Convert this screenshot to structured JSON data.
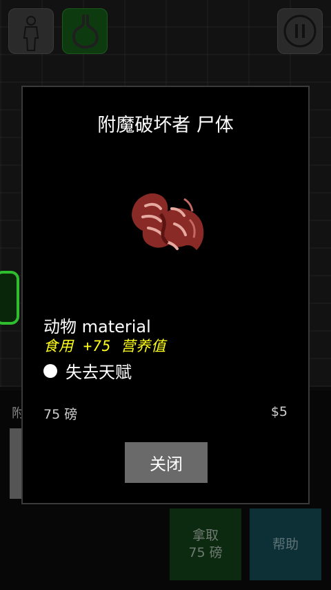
{
  "background": {
    "partial_label": "附",
    "take_button_label_line1": "拿取",
    "take_button_label_line2": "75 磅",
    "help_button_label": "帮助"
  },
  "icons": {
    "body": "body-silhouette-icon",
    "stomach": "stomach-icon",
    "pause": "pause-icon"
  },
  "dialog": {
    "title": "附魔破坏者 尸体",
    "material": "动物 material",
    "food_value": "食用 +75 营养值",
    "trait": "失去天赋",
    "weight": "75 磅",
    "price": "$5",
    "close_label": "关闭"
  },
  "colors": {
    "food_text": "#ffff1a",
    "stomach_button": "#0e3a10",
    "take_button": "#0c2a10",
    "help_button": "#0c3036"
  }
}
